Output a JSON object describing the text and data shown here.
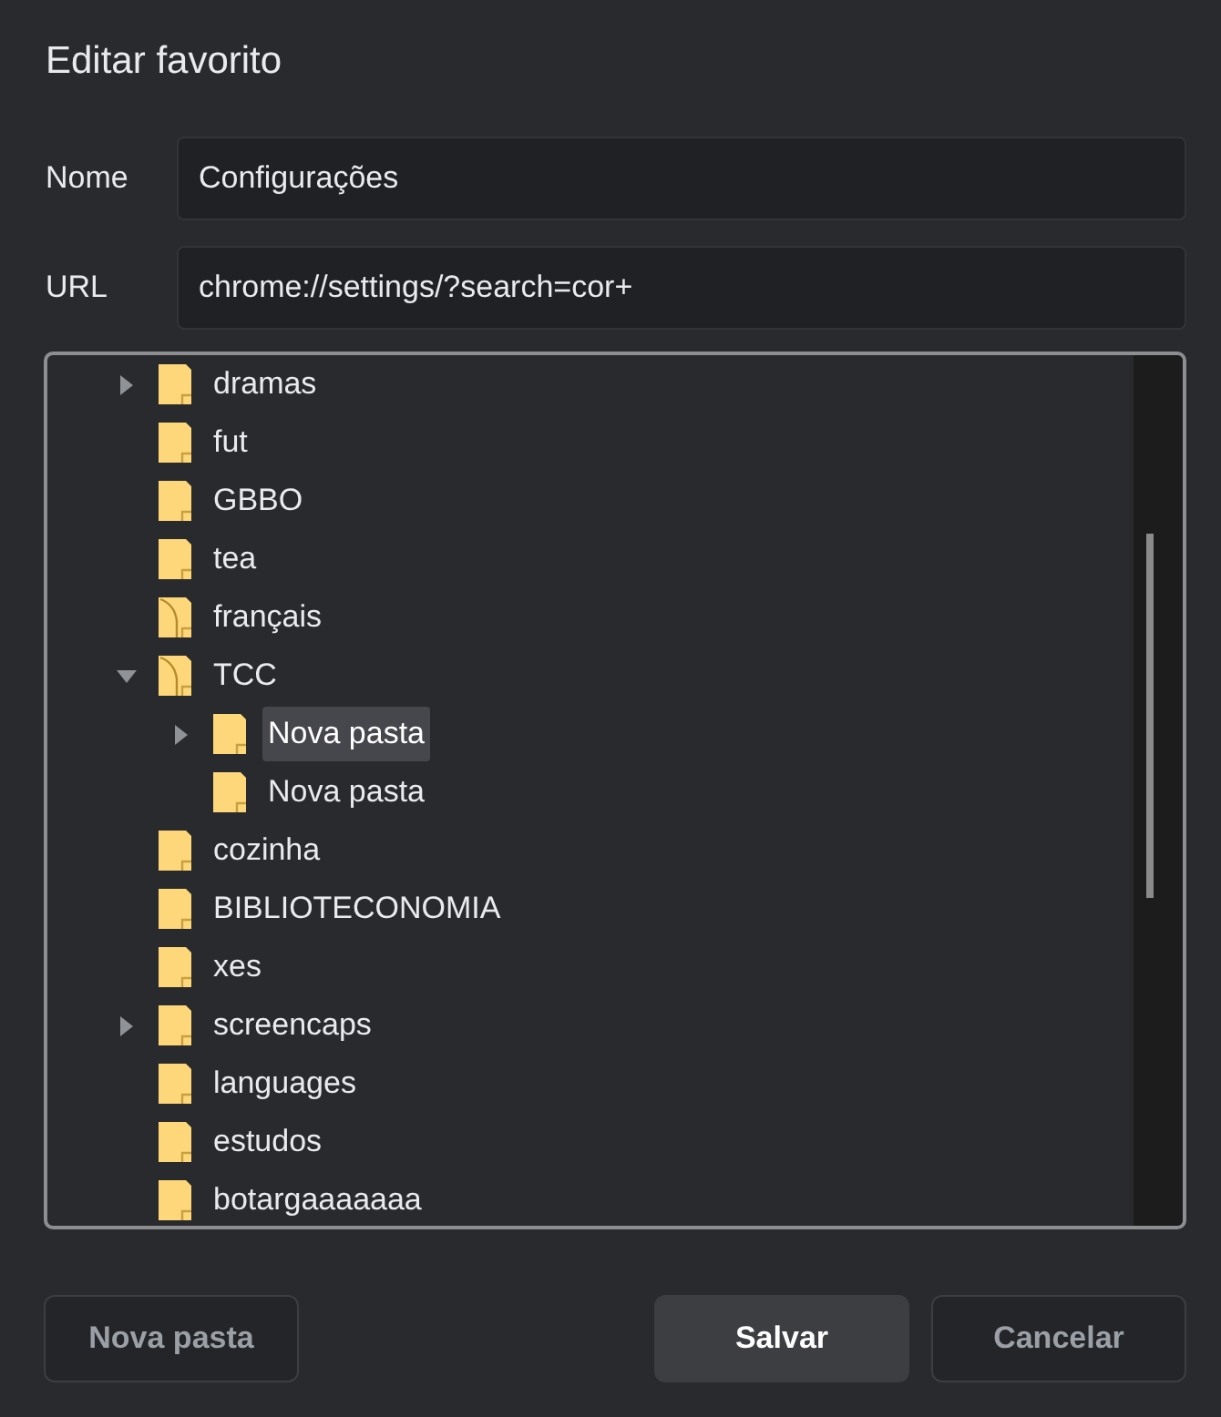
{
  "dialog": {
    "title": "Editar favorito"
  },
  "fields": [
    {
      "label": "Nome",
      "value": "Configurações"
    },
    {
      "label": "URL",
      "value": "chrome://settings/?search=cor+"
    }
  ],
  "folder_tree": {
    "items": [
      {
        "name": "dramas",
        "expanded": false,
        "open": false,
        "selected": false
      },
      {
        "name": "fut",
        "open": false,
        "selected": false
      },
      {
        "name": "GBBO",
        "open": false,
        "selected": false
      },
      {
        "name": "tea",
        "open": false,
        "selected": false
      },
      {
        "name": "français",
        "open": true,
        "selected": false
      },
      {
        "name": "TCC",
        "expanded": true,
        "open": true,
        "selected": false,
        "children": [
          {
            "name": "Nova pasta",
            "expanded": false,
            "open": false,
            "selected": true
          },
          {
            "name": "Nova pasta",
            "open": false,
            "selected": false
          }
        ]
      },
      {
        "name": "cozinha",
        "open": false,
        "selected": false
      },
      {
        "name": "BIBLIOTECONOMIA",
        "open": false,
        "selected": false
      },
      {
        "name": "xes",
        "open": false,
        "selected": false
      },
      {
        "name": "screencaps",
        "expanded": false,
        "open": false,
        "selected": false
      },
      {
        "name": "languages",
        "open": false,
        "selected": false
      },
      {
        "name": "estudos",
        "open": false,
        "selected": false
      },
      {
        "name": "botargaaaaaaa",
        "open": false,
        "selected": false
      }
    ]
  },
  "footer": {
    "left_buttons": [
      {
        "label": "Nova pasta",
        "kind": "secondary"
      }
    ],
    "right_buttons": [
      {
        "label": "Salvar",
        "kind": "primary"
      },
      {
        "label": "Cancelar",
        "kind": "secondary"
      }
    ]
  }
}
